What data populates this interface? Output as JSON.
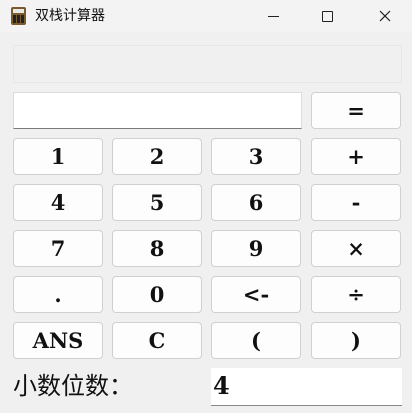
{
  "window": {
    "title": "双栈计算器",
    "minimize_glyph": "—",
    "maximize_glyph": "☐",
    "close_glyph": "✕"
  },
  "display": {
    "history_text": "",
    "expression_value": ""
  },
  "buttons": {
    "equals": "=",
    "one": "1",
    "two": "2",
    "three": "3",
    "plus": "+",
    "four": "4",
    "five": "5",
    "six": "6",
    "minus": "-",
    "seven": "7",
    "eight": "8",
    "nine": "9",
    "multiply": "×",
    "dot": ".",
    "zero": "0",
    "backspace": "<-",
    "divide": "÷",
    "ans": "ANS",
    "clear": "C",
    "lparen": "(",
    "rparen": ")"
  },
  "decimal": {
    "label": "小数位数：",
    "value": "4"
  },
  "icons": {
    "app": "calculator-icon",
    "minimize": "minimize-icon",
    "maximize": "maximize-icon",
    "close": "close-icon"
  }
}
